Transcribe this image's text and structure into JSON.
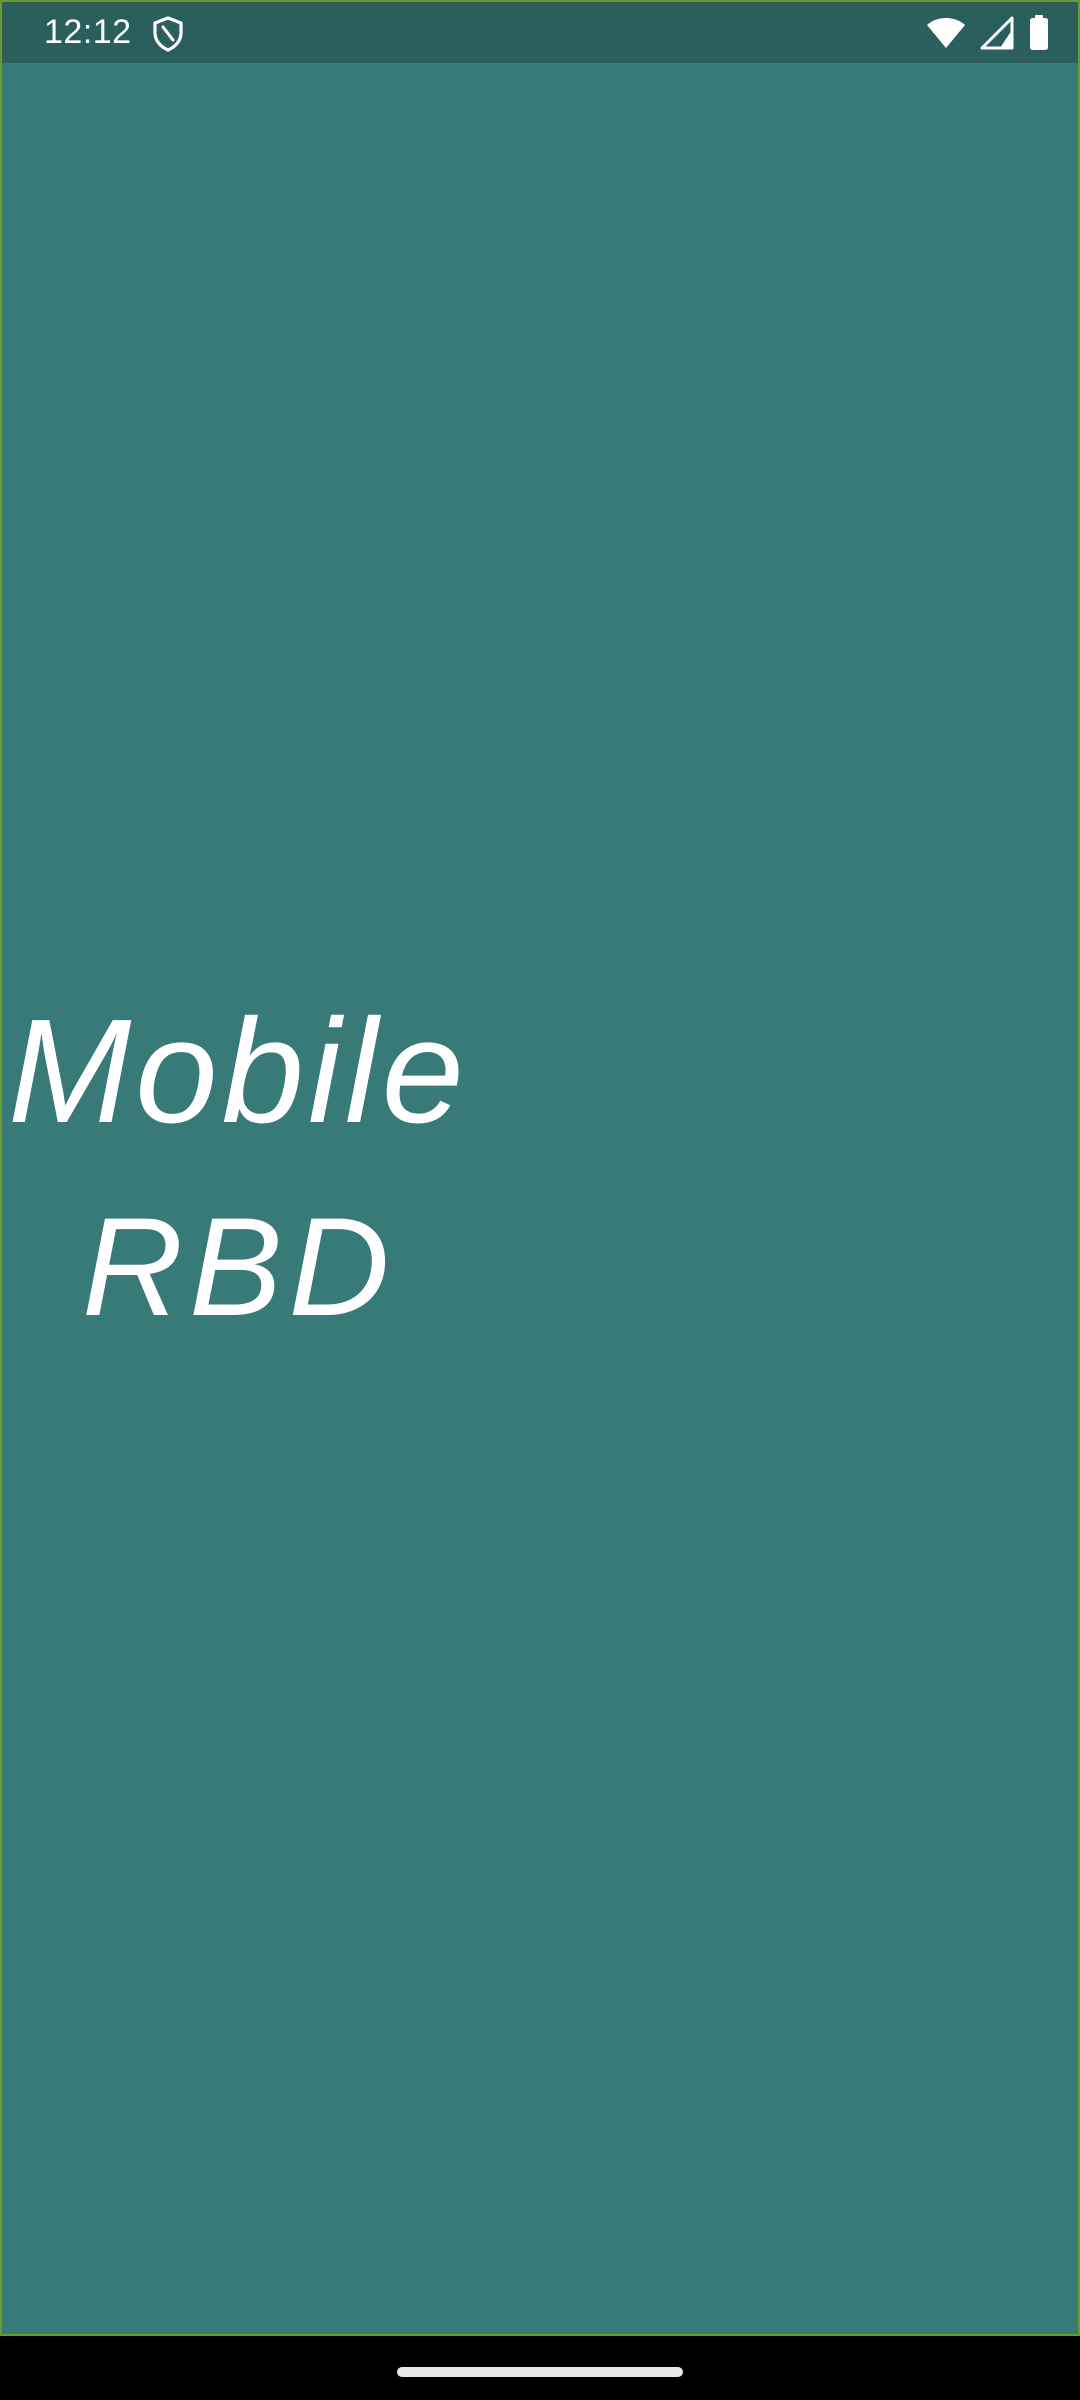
{
  "status_bar": {
    "time": "12:12",
    "left_icons": [
      "shield-icon"
    ],
    "right_icons": [
      "wifi-icon",
      "signal-icon",
      "battery-icon"
    ]
  },
  "splash": {
    "title_line1": "Mobile",
    "title_line2": "RBD"
  },
  "colors": {
    "background": "#377a78",
    "status_bar": "#2b5f5e",
    "frame_border": "#6a9a2a",
    "text": "#ffffff",
    "nav_bar": "#000000"
  }
}
